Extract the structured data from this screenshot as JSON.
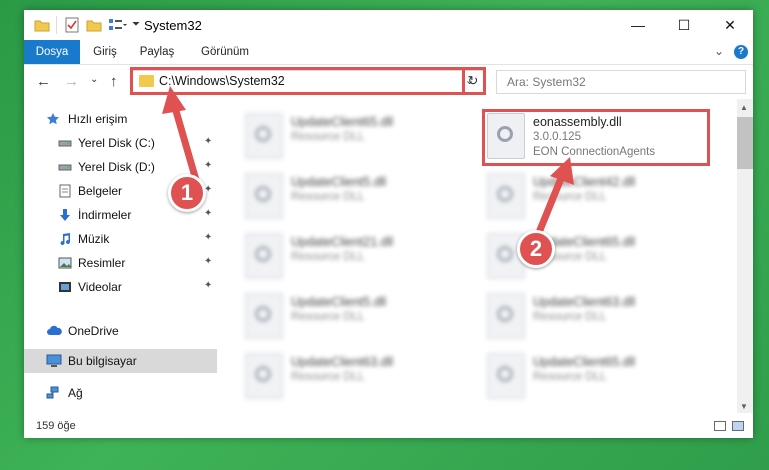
{
  "window": {
    "title": "System32",
    "min": "—",
    "max": "☐",
    "close": "✕"
  },
  "ribbon": {
    "tabs": [
      "Dosya",
      "Giriş",
      "Paylaş",
      "Görünüm"
    ],
    "expand": "⌄",
    "help": "?"
  },
  "nav": {
    "back": "←",
    "forward": "→",
    "recent": "⌄",
    "up": "↑",
    "address": "C:\\Windows\\System32",
    "address_drop": "⌄",
    "refresh": "↻",
    "search_placeholder": "Ara: System32"
  },
  "sidebar": {
    "items": [
      {
        "label": "Hızlı erişim",
        "icon": "star-icon"
      },
      {
        "label": "Yerel Disk (C:)",
        "icon": "drive-icon"
      },
      {
        "label": "Yerel Disk (D:)",
        "icon": "drive-icon"
      },
      {
        "label": "Belgeler",
        "icon": "documents-icon"
      },
      {
        "label": "İndirmeler",
        "icon": "download-icon"
      },
      {
        "label": "Müzik",
        "icon": "music-icon"
      },
      {
        "label": "Resimler",
        "icon": "pictures-icon"
      },
      {
        "label": "Videolar",
        "icon": "video-icon"
      },
      {
        "label": "OneDrive",
        "icon": "cloud-icon"
      },
      {
        "label": "Bu bilgisayar",
        "icon": "computer-icon"
      },
      {
        "label": "Ağ",
        "icon": "network-icon"
      }
    ],
    "pin": "📌"
  },
  "files": {
    "highlighted": {
      "name": "eonassembly.dll",
      "version": "3.0.0.125",
      "company": "EON ConnectionAgents"
    },
    "left": [
      {
        "name": "UpdateClient65.dll",
        "type": "Resource DLL"
      },
      {
        "name": "UpdateClient5.dll",
        "type": "Resource DLL"
      },
      {
        "name": "UpdateClient21.dll",
        "type": "Resource DLL"
      },
      {
        "name": "UpdateClient5.dll",
        "type": "Resource DLL"
      },
      {
        "name": "UpdateClient63.dll",
        "type": "Resource DLL"
      }
    ],
    "right": [
      {
        "name": "UpdateClient42.dll",
        "type": "Resource DLL"
      },
      {
        "name": "UpdateClient65.dll",
        "type": "Resource DLL"
      },
      {
        "name": "UpdateClient63.dll",
        "type": "Resource DLL"
      },
      {
        "name": "UpdateClient65.dll",
        "type": "Resource DLL"
      }
    ]
  },
  "status": {
    "count": "159 öğe"
  },
  "annotations": {
    "badge1": "1",
    "badge2": "2"
  },
  "colors": {
    "accent": "#1979ca",
    "highlight": "#e05151",
    "background": "#3fb357"
  }
}
